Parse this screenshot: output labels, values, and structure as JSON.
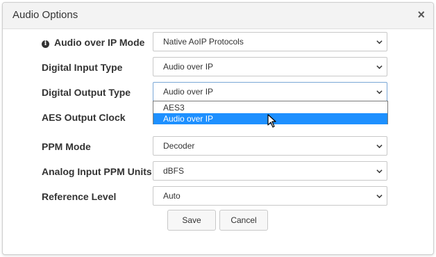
{
  "dialog": {
    "title": "Audio Options",
    "close_glyph": "×"
  },
  "fields": [
    {
      "label": "Audio over IP Mode",
      "value": "Native AoIP Protocols",
      "icon": "info-icon"
    },
    {
      "label": "Digital Input Type",
      "value": "Audio over IP"
    },
    {
      "label": "Digital Output Type",
      "value": "Audio over IP"
    },
    {
      "label": "AES Output Clock",
      "value": ""
    },
    {
      "label": "PPM Mode",
      "value": "Decoder"
    },
    {
      "label": "Analog Input PPM Units",
      "value": "dBFS"
    },
    {
      "label": "Reference Level",
      "value": "Auto"
    }
  ],
  "dropdown_options": [
    "AES3",
    "Audio over IP"
  ],
  "dropdown_selected": "Audio over IP",
  "buttons": {
    "save": "Save",
    "cancel": "Cancel"
  },
  "colors": {
    "highlight": "#1e90ff",
    "header_bg": "#f3f3f3"
  }
}
